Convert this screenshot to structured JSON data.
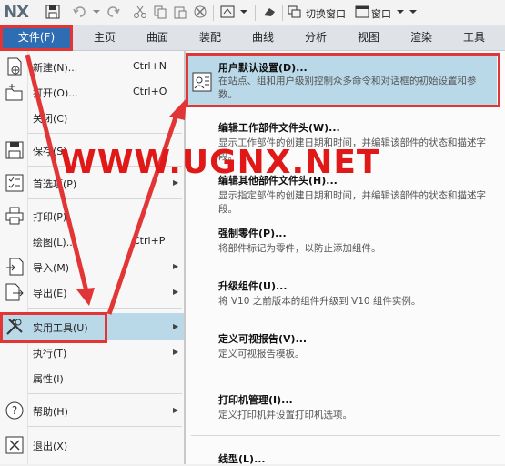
{
  "toolbar": {
    "logo": "NX",
    "switch_window": "切换窗口",
    "window": "窗口"
  },
  "menubar": {
    "file": "文件(F)",
    "items": [
      "主页",
      "曲面",
      "装配",
      "曲线",
      "分析",
      "视图",
      "渲染",
      "工具"
    ]
  },
  "file_menu": {
    "items": [
      {
        "label": "新建(N)...",
        "shortcut": "Ctrl+N"
      },
      {
        "label": "打开(O)...",
        "shortcut": "Ctrl+O"
      },
      {
        "label": "关闭(C)"
      },
      {
        "label": "保存(S)"
      },
      {
        "label": "首选项(P)"
      },
      {
        "label": "打印(P)"
      },
      {
        "label": "绘图(L)...",
        "shortcut": "Ctrl+P"
      },
      {
        "label": "导入(M)"
      },
      {
        "label": "导出(E)"
      },
      {
        "label": "实用工具(U)"
      },
      {
        "label": "执行(T)"
      },
      {
        "label": "属性(I)"
      },
      {
        "label": "帮助(H)"
      },
      {
        "label": "退出(X)"
      }
    ]
  },
  "submenu": {
    "items": [
      {
        "title": "用户默认设置(D)...",
        "desc": "在站点、组和用户级别控制众多命令和对话框的初始设置和参数。"
      },
      {
        "title": "编辑工作部件文件头(W)...",
        "desc": "显示工作部件的创建日期和时间，并编辑该部件的状态和描述字段。"
      },
      {
        "title": "编辑其他部件文件头(H)...",
        "desc": "显示指定部件的创建日期和时间，并编辑该部件的状态和描述字段。"
      },
      {
        "title": "强制零件(P)...",
        "desc": "将部件标记为零件，以防止添加组件。"
      },
      {
        "title": "升级组件(U)...",
        "desc": "将 V10 之前版本的组件升级到 V10 组件实例。"
      },
      {
        "title": "定义可视报告(V)...",
        "desc": "定义可视报告模板。"
      },
      {
        "title": "打印机管理(I)...",
        "desc": "定义打印机并设置打印机选项。"
      },
      {
        "title": "线型(L)..."
      }
    ]
  },
  "watermark": "WWW.UGNX.NET",
  "colors": {
    "accent": "#2f6db3",
    "highlight": "#b9d8e8",
    "annotation_red": "#e23636"
  }
}
